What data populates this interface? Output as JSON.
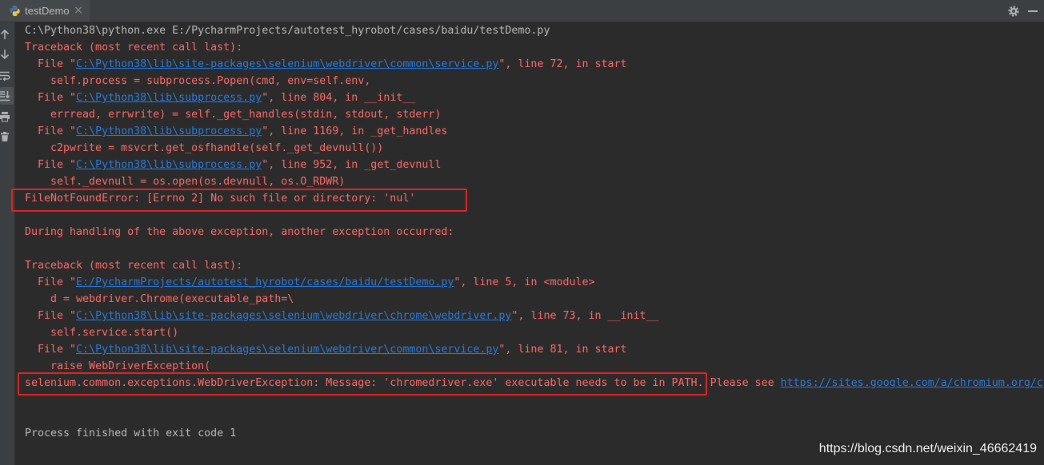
{
  "tab": {
    "title": "testDemo",
    "close": "×",
    "icon": "python-icon"
  },
  "toolbar": {
    "icons": [
      "gear-icon",
      "minimize-icon"
    ]
  },
  "sidebar": {
    "icons": [
      "arrow-up-icon",
      "arrow-down-icon",
      "soft-wrap-icon",
      "scroll-to-end-icon",
      "print-icon",
      "trash-icon"
    ],
    "active_icon": "scroll-to-end-icon"
  },
  "colors": {
    "background": "#2B2B2B",
    "panel": "#3C3F41",
    "stdout": "#BBBBBB",
    "stderr": "#FF6B68",
    "link": "#287BDE",
    "highlight": "#E02424"
  },
  "console": {
    "lines": [
      {
        "segments": [
          {
            "text": "C:\\Python38\\python.exe E:/PycharmProjects/autotest_hyrobot/cases/baidu/testDemo.py"
          }
        ]
      },
      {
        "segments": [
          {
            "text": "Traceback (most recent call last):"
          }
        ]
      },
      {
        "segments": [
          {
            "text": "  File \""
          },
          {
            "text": "C:\\Python38\\lib\\site-packages\\selenium\\webdriver\\common\\service.py",
            "link": true
          },
          {
            "text": "\", line 72, in start"
          }
        ]
      },
      {
        "segments": [
          {
            "text": "    self.process = subprocess.Popen(cmd, env=self.env,"
          }
        ]
      },
      {
        "segments": [
          {
            "text": "  File \""
          },
          {
            "text": "C:\\Python38\\lib\\subprocess.py",
            "link": true
          },
          {
            "text": "\", line 804, in __init__"
          }
        ]
      },
      {
        "segments": [
          {
            "text": "    errread, errwrite) = self._get_handles(stdin, stdout, stderr)"
          }
        ]
      },
      {
        "segments": [
          {
            "text": "  File \""
          },
          {
            "text": "C:\\Python38\\lib\\subprocess.py",
            "link": true
          },
          {
            "text": "\", line 1169, in _get_handles"
          }
        ]
      },
      {
        "segments": [
          {
            "text": "    c2pwrite = msvcrt.get_osfhandle(self._get_devnull())"
          }
        ]
      },
      {
        "segments": [
          {
            "text": "  File \""
          },
          {
            "text": "C:\\Python38\\lib\\subprocess.py",
            "link": true
          },
          {
            "text": "\", line 952, in _get_devnull"
          }
        ]
      },
      {
        "segments": [
          {
            "text": "    self._devnull = os.open(os.devnull, os.O_RDWR)"
          }
        ]
      },
      {
        "segments": [
          {
            "text": "FileNotFoundError: [Errno 2] No such file or directory: 'nul'"
          }
        ]
      },
      {
        "segments": [
          {
            "text": "During handling of the above exception, another exception occurred:"
          }
        ]
      },
      {
        "segments": [
          {
            "text": "Traceback (most recent call last):"
          }
        ]
      },
      {
        "segments": [
          {
            "text": "  File \""
          },
          {
            "text": "E:/PycharmProjects/autotest_hyrobot/cases/baidu/testDemo.py",
            "link": true
          },
          {
            "text": "\", line 5, in <module>"
          }
        ]
      },
      {
        "segments": [
          {
            "text": "    d = webdriver.Chrome(executable_path=\\"
          }
        ]
      },
      {
        "segments": [
          {
            "text": "  File \""
          },
          {
            "text": "C:\\Python38\\lib\\site-packages\\selenium\\webdriver\\chrome\\webdriver.py",
            "link": true
          },
          {
            "text": "\", line 73, in __init__"
          }
        ]
      },
      {
        "segments": [
          {
            "text": "    self.service.start()"
          }
        ]
      },
      {
        "segments": [
          {
            "text": "  File \""
          },
          {
            "text": "C:\\Python38\\lib\\site-packages\\selenium\\webdriver\\common\\service.py",
            "link": true
          },
          {
            "text": "\", line 81, in start"
          }
        ]
      },
      {
        "segments": [
          {
            "text": "    raise WebDriverException("
          }
        ]
      },
      {
        "segments": [
          {
            "text": "selenium.common.exceptions.WebDriverException: Message: 'chromedriver.exe' executable needs to be in PATH. Please see "
          },
          {
            "text": "https://sites.google.com/a/chromium.org/c",
            "link": true
          }
        ]
      },
      {
        "segments": [
          {
            "text": "Process finished with exit code 1"
          }
        ]
      }
    ]
  },
  "watermark": {
    "text": "https://blog.csdn.net/weixin_46662419"
  }
}
